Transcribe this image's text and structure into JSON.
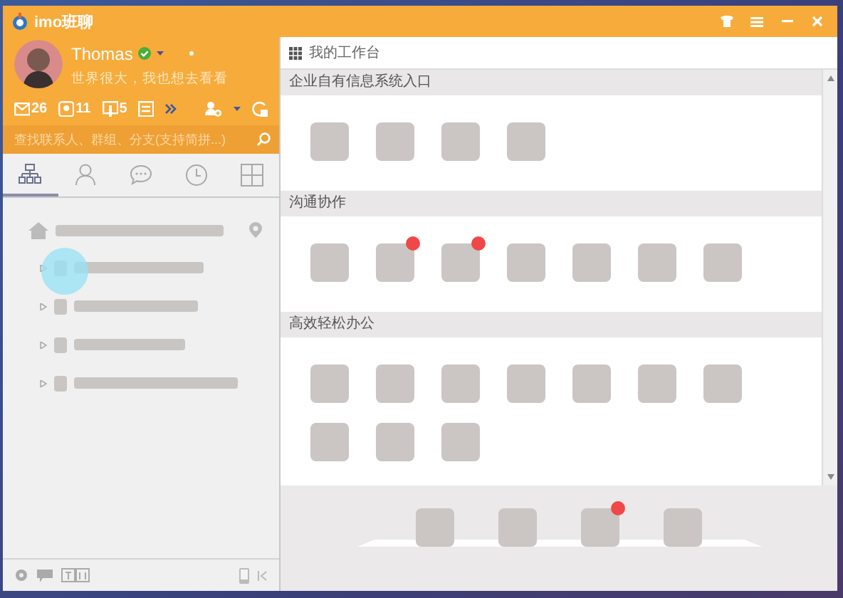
{
  "window": {
    "title": "imo班聊"
  },
  "profile": {
    "name": "Thomas",
    "online": true,
    "signature": "世界很大，我也想去看看"
  },
  "counters": [
    {
      "kind": "mail",
      "count": "26"
    },
    {
      "kind": "group",
      "count": "11"
    },
    {
      "kind": "notice",
      "count": "5"
    },
    {
      "kind": "note"
    }
  ],
  "contact_search": {
    "placeholder": "查找联系人、群组、分支(支持简拼...)"
  },
  "tabs": [
    {
      "kind": "org",
      "selected": true
    },
    {
      "kind": "person",
      "selected": false
    },
    {
      "kind": "chat",
      "selected": false
    },
    {
      "kind": "clock",
      "selected": false
    },
    {
      "kind": "apps",
      "selected": false
    }
  ],
  "tree": {
    "root": {
      "kind": "home"
    },
    "children": [
      {
        "expanded": false
      },
      {
        "expanded": false
      },
      {
        "expanded": false
      },
      {
        "expanded": false
      }
    ]
  },
  "workbench_search": {
    "placeholder": "我的工作台"
  },
  "sections": [
    {
      "title": "企业自有信息系统入口",
      "apps": [
        {
          "badge": false
        },
        {
          "badge": false
        },
        {
          "badge": false
        },
        {
          "badge": false
        }
      ]
    },
    {
      "title": "沟通协作",
      "apps": [
        {
          "badge": false
        },
        {
          "badge": true
        },
        {
          "badge": true
        },
        {
          "badge": false
        },
        {
          "badge": false
        },
        {
          "badge": false
        },
        {
          "badge": false
        }
      ]
    },
    {
      "title": "高效轻松办公",
      "apps": [
        {
          "badge": false
        },
        {
          "badge": false
        },
        {
          "badge": false
        },
        {
          "badge": false
        },
        {
          "badge": false
        },
        {
          "badge": false
        },
        {
          "badge": false
        },
        {
          "badge": false
        },
        {
          "badge": false
        },
        {
          "badge": false
        }
      ]
    }
  ],
  "dock": [
    {
      "badge": false
    },
    {
      "badge": false
    },
    {
      "badge": true
    },
    {
      "badge": false
    }
  ]
}
